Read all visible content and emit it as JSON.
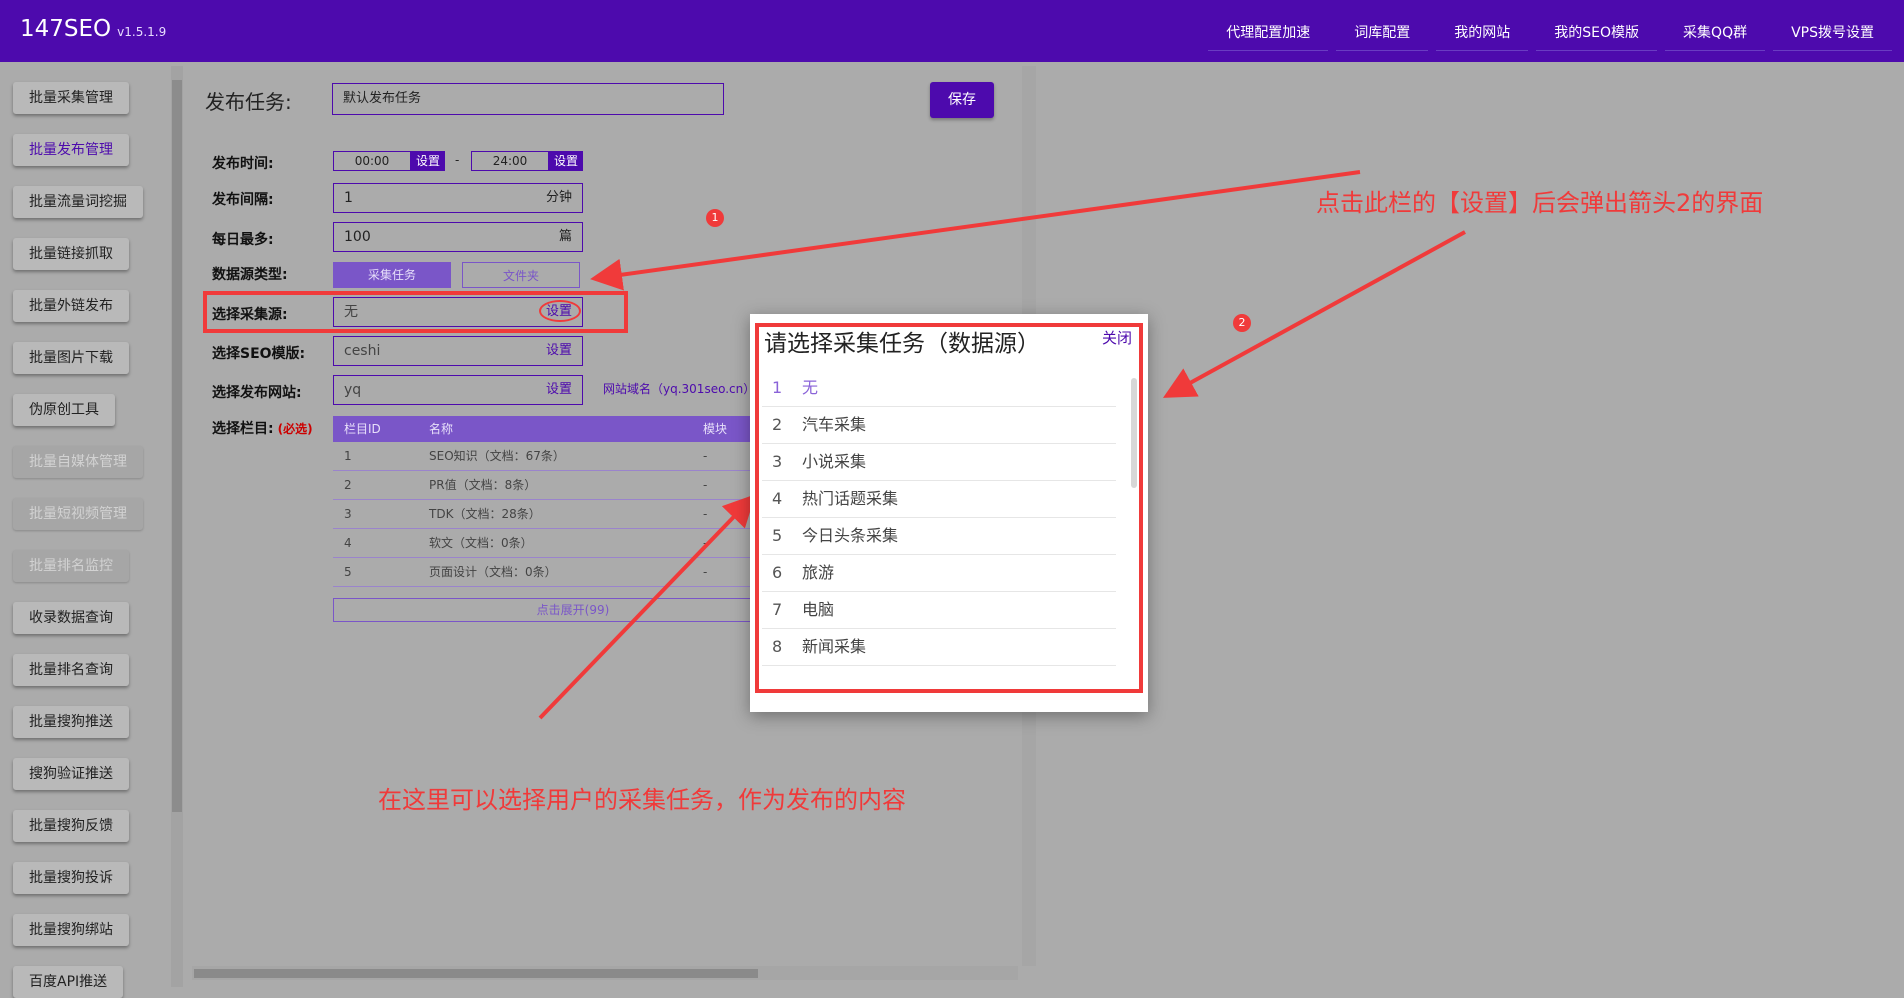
{
  "app": {
    "name": "147SEO",
    "version": "v1.5.1.9"
  },
  "topnav": [
    "代理配置加速",
    "词库配置",
    "我的网站",
    "我的SEO模版",
    "采集QQ群",
    "VPS拨号设置"
  ],
  "sidebar": {
    "items": [
      {
        "label": "批量采集管理"
      },
      {
        "label": "批量发布管理"
      },
      {
        "label": "批量流量词挖掘"
      },
      {
        "label": "批量链接抓取"
      },
      {
        "label": "批量外链发布"
      },
      {
        "label": "批量图片下载"
      },
      {
        "label": "伪原创工具"
      },
      {
        "label": "批量自媒体管理"
      },
      {
        "label": "批量短视频管理"
      },
      {
        "label": "批量排名监控"
      },
      {
        "label": "收录数据查询"
      },
      {
        "label": "批量排名查询"
      },
      {
        "label": "批量搜狗推送"
      },
      {
        "label": "搜狗验证推送"
      },
      {
        "label": "批量搜狗反馈"
      },
      {
        "label": "批量搜狗投诉"
      },
      {
        "label": "批量搜狗绑站"
      },
      {
        "label": "百度API推送"
      }
    ]
  },
  "form": {
    "task_label": "发布任务:",
    "task_value": "默认发布任务",
    "save_label": "保存",
    "time_label": "发布时间:",
    "time_start": "00:00",
    "time_end": "24:00",
    "time_dash": "-",
    "set_label": "设置",
    "interval_label": "发布间隔:",
    "interval_value": "1",
    "interval_unit": "分钟",
    "daily_label": "每日最多:",
    "daily_value": "100",
    "daily_unit": "篇",
    "source_type_label": "数据源类型:",
    "source_type_task": "采集任务",
    "source_type_folder": "文件夹",
    "source_label": "选择采集源:",
    "source_value": "无",
    "seo_label": "选择SEO模版:",
    "seo_value": "ceshi",
    "site_label": "选择发布网站:",
    "site_value": "yq",
    "site_hint": "网站域名（yq.301seo.cn）",
    "column_label": "选择栏目:",
    "column_required": "(必选)"
  },
  "column_table": {
    "headers": [
      "栏目ID",
      "名称",
      "模块"
    ],
    "rows": [
      [
        "1",
        "SEO知识（文档：67条）",
        "-"
      ],
      [
        "2",
        "PR值（文档：8条）",
        "-"
      ],
      [
        "3",
        "TDK（文档：28条）",
        "-"
      ],
      [
        "4",
        "软文（文档：0条）",
        "-"
      ],
      [
        "5",
        "页面设计（文档：0条）",
        "-"
      ]
    ],
    "expand_label": "点击展开(99)"
  },
  "modal": {
    "title": "请选择采集任务（数据源）",
    "close_label": "关闭",
    "items": [
      {
        "num": "1",
        "name": "无"
      },
      {
        "num": "2",
        "name": "汽车采集"
      },
      {
        "num": "3",
        "name": "小说采集"
      },
      {
        "num": "4",
        "name": "热门话题采集"
      },
      {
        "num": "5",
        "name": "今日头条采集"
      },
      {
        "num": "6",
        "name": "旅游"
      },
      {
        "num": "7",
        "name": "电脑"
      },
      {
        "num": "8",
        "name": "新闻采集"
      }
    ],
    "selected_index": 0
  },
  "annotations": {
    "badge1": "1",
    "badge2": "2",
    "text1": "点击此栏的【设置】后会弹出箭头2的界面",
    "text2": "在这里可以选择用户的采集任务，作为发布的内容"
  },
  "colors": {
    "brand": "#4d0aad",
    "annotation_red": "#f03a3a",
    "selected_item": "#8a63d8"
  }
}
